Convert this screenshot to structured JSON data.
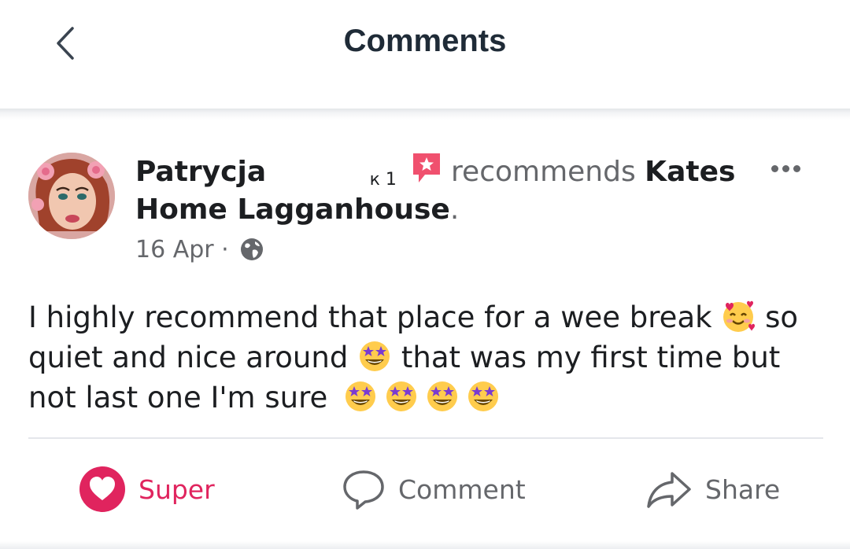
{
  "header": {
    "title": "Comments"
  },
  "post": {
    "author": "Patrycja",
    "author_redacted_tail": "к 1",
    "action_text": "recommends",
    "page_name": "Kates Home Lagganhouse",
    "trailing_punct": ".",
    "date": "16 Apr",
    "date_separator": "·",
    "body_parts": [
      "I highly recommend that place for a wee break",
      "so quiet and nice around",
      "that was my first time but not last one I'm sure"
    ]
  },
  "actions": {
    "super_label": "Super",
    "comment_label": "Comment",
    "share_label": "Share"
  },
  "colors": {
    "accent_red": "#e0245e",
    "badge_red": "#f0506e",
    "muted_gray": "#65676b"
  },
  "icons": [
    "back-arrow-icon",
    "recommend-badge-icon",
    "more-options-icon",
    "globe-icon",
    "heart-icon",
    "comment-icon",
    "share-icon"
  ]
}
